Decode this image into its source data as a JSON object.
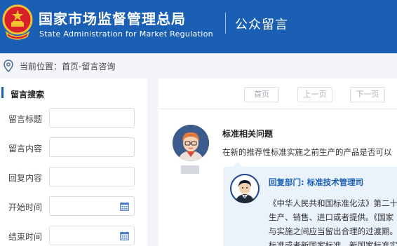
{
  "header": {
    "title_cn": "国家市场监督管理总局",
    "title_en": "State Administration for Market Regulation",
    "section": "公众留言"
  },
  "breadcrumb": {
    "label": "当前位置：",
    "path": "首页-留言咨询"
  },
  "sidebar": {
    "title": "留言搜索",
    "fields": [
      {
        "label": "留言标题",
        "value": ""
      },
      {
        "label": "留言内容",
        "value": ""
      },
      {
        "label": "回复内容",
        "value": ""
      },
      {
        "label": "开始时间",
        "value": ""
      },
      {
        "label": "结束时间",
        "value": ""
      }
    ]
  },
  "pager": {
    "first": "首页",
    "prev": "上一页",
    "next": "下一页"
  },
  "message": {
    "title": "标准相关问题",
    "body": "在新的推荐性标准实施之前生产的产品是否可以"
  },
  "reply": {
    "dept": "回复部门: 标准技术管理司",
    "lines": [
      "《中华人民共和国标准化法》第二十",
      "生产、销售、进口或者提供。《国家",
      "与实施之间应当留出合理的过渡期。",
      "标准或者新国家标准。新国家标准实"
    ]
  },
  "colors": {
    "header_bg": "#1a5fb4",
    "reply_bg": "#eaf2fb",
    "accent": "#1a5fb4"
  },
  "icons": [
    "national-emblem-icon",
    "location-pin-icon",
    "calendar-icon",
    "user-avatar",
    "official-avatar"
  ]
}
